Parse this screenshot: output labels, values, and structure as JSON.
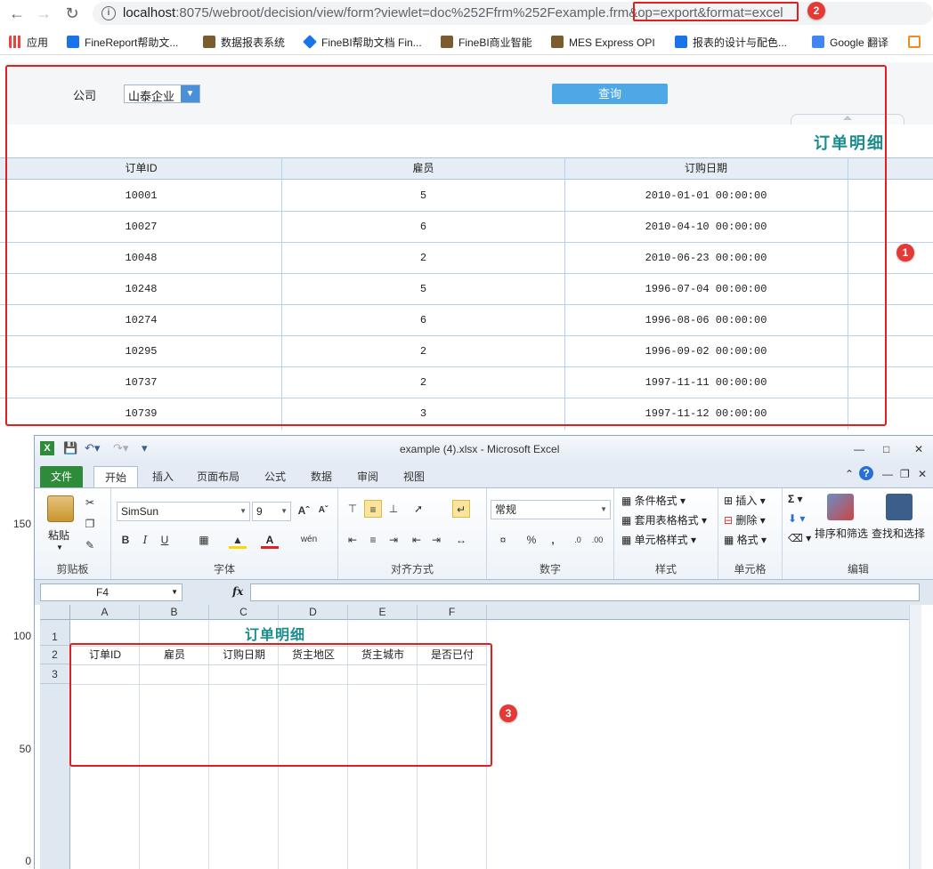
{
  "browser": {
    "url_host": "localhost",
    "url_rest": ":8075/webroot/decision/view/form?viewlet=doc%252Ffrm%252Fexample.frm",
    "url_highlight": "&op=export&format=excel",
    "bookmarks": [
      {
        "label": "应用",
        "color": "#e8453c"
      },
      {
        "label": "FineReport帮助文...",
        "color": "#1a73e8"
      },
      {
        "label": "数据报表系统",
        "color": "#7a5c2e"
      },
      {
        "label": "FineBI帮助文档 Fin...",
        "color": "#1a73e8"
      },
      {
        "label": "FineBI商业智能",
        "color": "#7a5c2e"
      },
      {
        "label": "MES Express OPI",
        "color": "#7a5c2e"
      },
      {
        "label": "报表的设计与配色...",
        "color": "#1a73e8"
      },
      {
        "label": "Google 翻译",
        "color": "#4285f4"
      },
      {
        "label": "",
        "color": "#f08a24"
      }
    ]
  },
  "badges": {
    "b1": "1",
    "b2": "2",
    "b3": "3"
  },
  "report": {
    "param_label": "公司",
    "company_value": "山泰企业",
    "query_label": "查询",
    "title": "订单明细",
    "columns": [
      "订单ID",
      "雇员",
      "订购日期"
    ],
    "rows": [
      [
        "10001",
        "5",
        "2010-01-01 00:00:00"
      ],
      [
        "10027",
        "6",
        "2010-04-10 00:00:00"
      ],
      [
        "10048",
        "2",
        "2010-06-23 00:00:00"
      ],
      [
        "10248",
        "5",
        "1996-07-04 00:00:00"
      ],
      [
        "10274",
        "6",
        "1996-08-06 00:00:00"
      ],
      [
        "10295",
        "2",
        "1996-09-02 00:00:00"
      ],
      [
        "10737",
        "2",
        "1997-11-11 00:00:00"
      ],
      [
        "10739",
        "3",
        "1997-11-12 00:00:00"
      ]
    ]
  },
  "y_axis": [
    "150",
    "100",
    "50",
    "0"
  ],
  "excel": {
    "window_title": "example (4).xlsx - Microsoft Excel",
    "tabs": [
      "文件",
      "开始",
      "插入",
      "页面布局",
      "公式",
      "数据",
      "审阅",
      "视图"
    ],
    "groups": {
      "clipboard": "剪贴板",
      "font": "字体",
      "alignment": "对齐方式",
      "number": "数字",
      "styles": "样式",
      "cells": "单元格",
      "editing": "编辑"
    },
    "paste_label": "粘贴",
    "font_name": "SimSun",
    "font_size": "9",
    "number_format": "常规",
    "styles_items": [
      "条件格式",
      "套用表格格式",
      "单元格样式"
    ],
    "cells_items": [
      "插入",
      "删除",
      "格式"
    ],
    "sort_label": "排序和筛选",
    "find_label": "查找和选择",
    "name_box": "F4",
    "fx_label": "fx",
    "col_headers": [
      "A",
      "B",
      "C",
      "D",
      "E",
      "F"
    ],
    "row_headers": [
      "1",
      "2",
      "3"
    ],
    "sheet_title": "订单明细",
    "header_cells": [
      "订单ID",
      "雇员",
      "订购日期",
      "货主地区",
      "货主城市",
      "是否已付"
    ]
  }
}
